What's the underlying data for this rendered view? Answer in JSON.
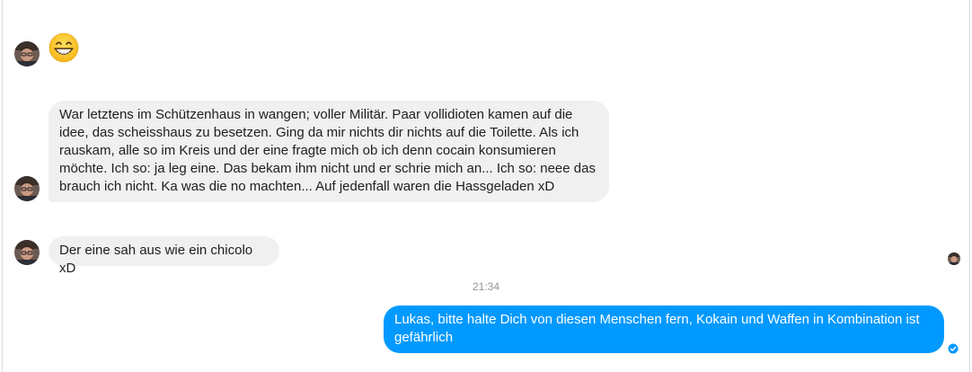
{
  "conversation": {
    "messages": [
      {
        "type": "emoji",
        "emoji_name": "grinning-face-icon",
        "direction": "incoming"
      },
      {
        "type": "text",
        "direction": "incoming",
        "text": "War letztens im Schützenhaus in wangen; voller Militär. Paar vollidioten kamen auf die idee, das scheisshaus zu besetzen. Ging da mir nichts dir nichts auf die Toilette. Als ich rauskam, alle so im Kreis und der eine fragte mich ob ich denn cocain konsumieren möchte. Ich so: ja leg eine. Das bekam ihm nicht und er schrie mich an... Ich so: neee das brauch ich nicht. Ka was die no machten... Auf jedenfall waren die Hassgeladen xD"
      },
      {
        "type": "text",
        "direction": "incoming",
        "text": "Der eine sah aus wie ein chicolo xD"
      },
      {
        "type": "text",
        "direction": "outgoing",
        "text": "Lukas, bitte halte Dich von diesen Menschen fern, Kokain und Waffen in Kombination ist gefährlich"
      }
    ],
    "timestamp": "21:34",
    "outgoing_status": "sent-check-icon"
  },
  "colors": {
    "incoming_bubble": "#f1f0f0",
    "outgoing_bubble": "#0099ff",
    "timestamp_text": "#90949c"
  }
}
